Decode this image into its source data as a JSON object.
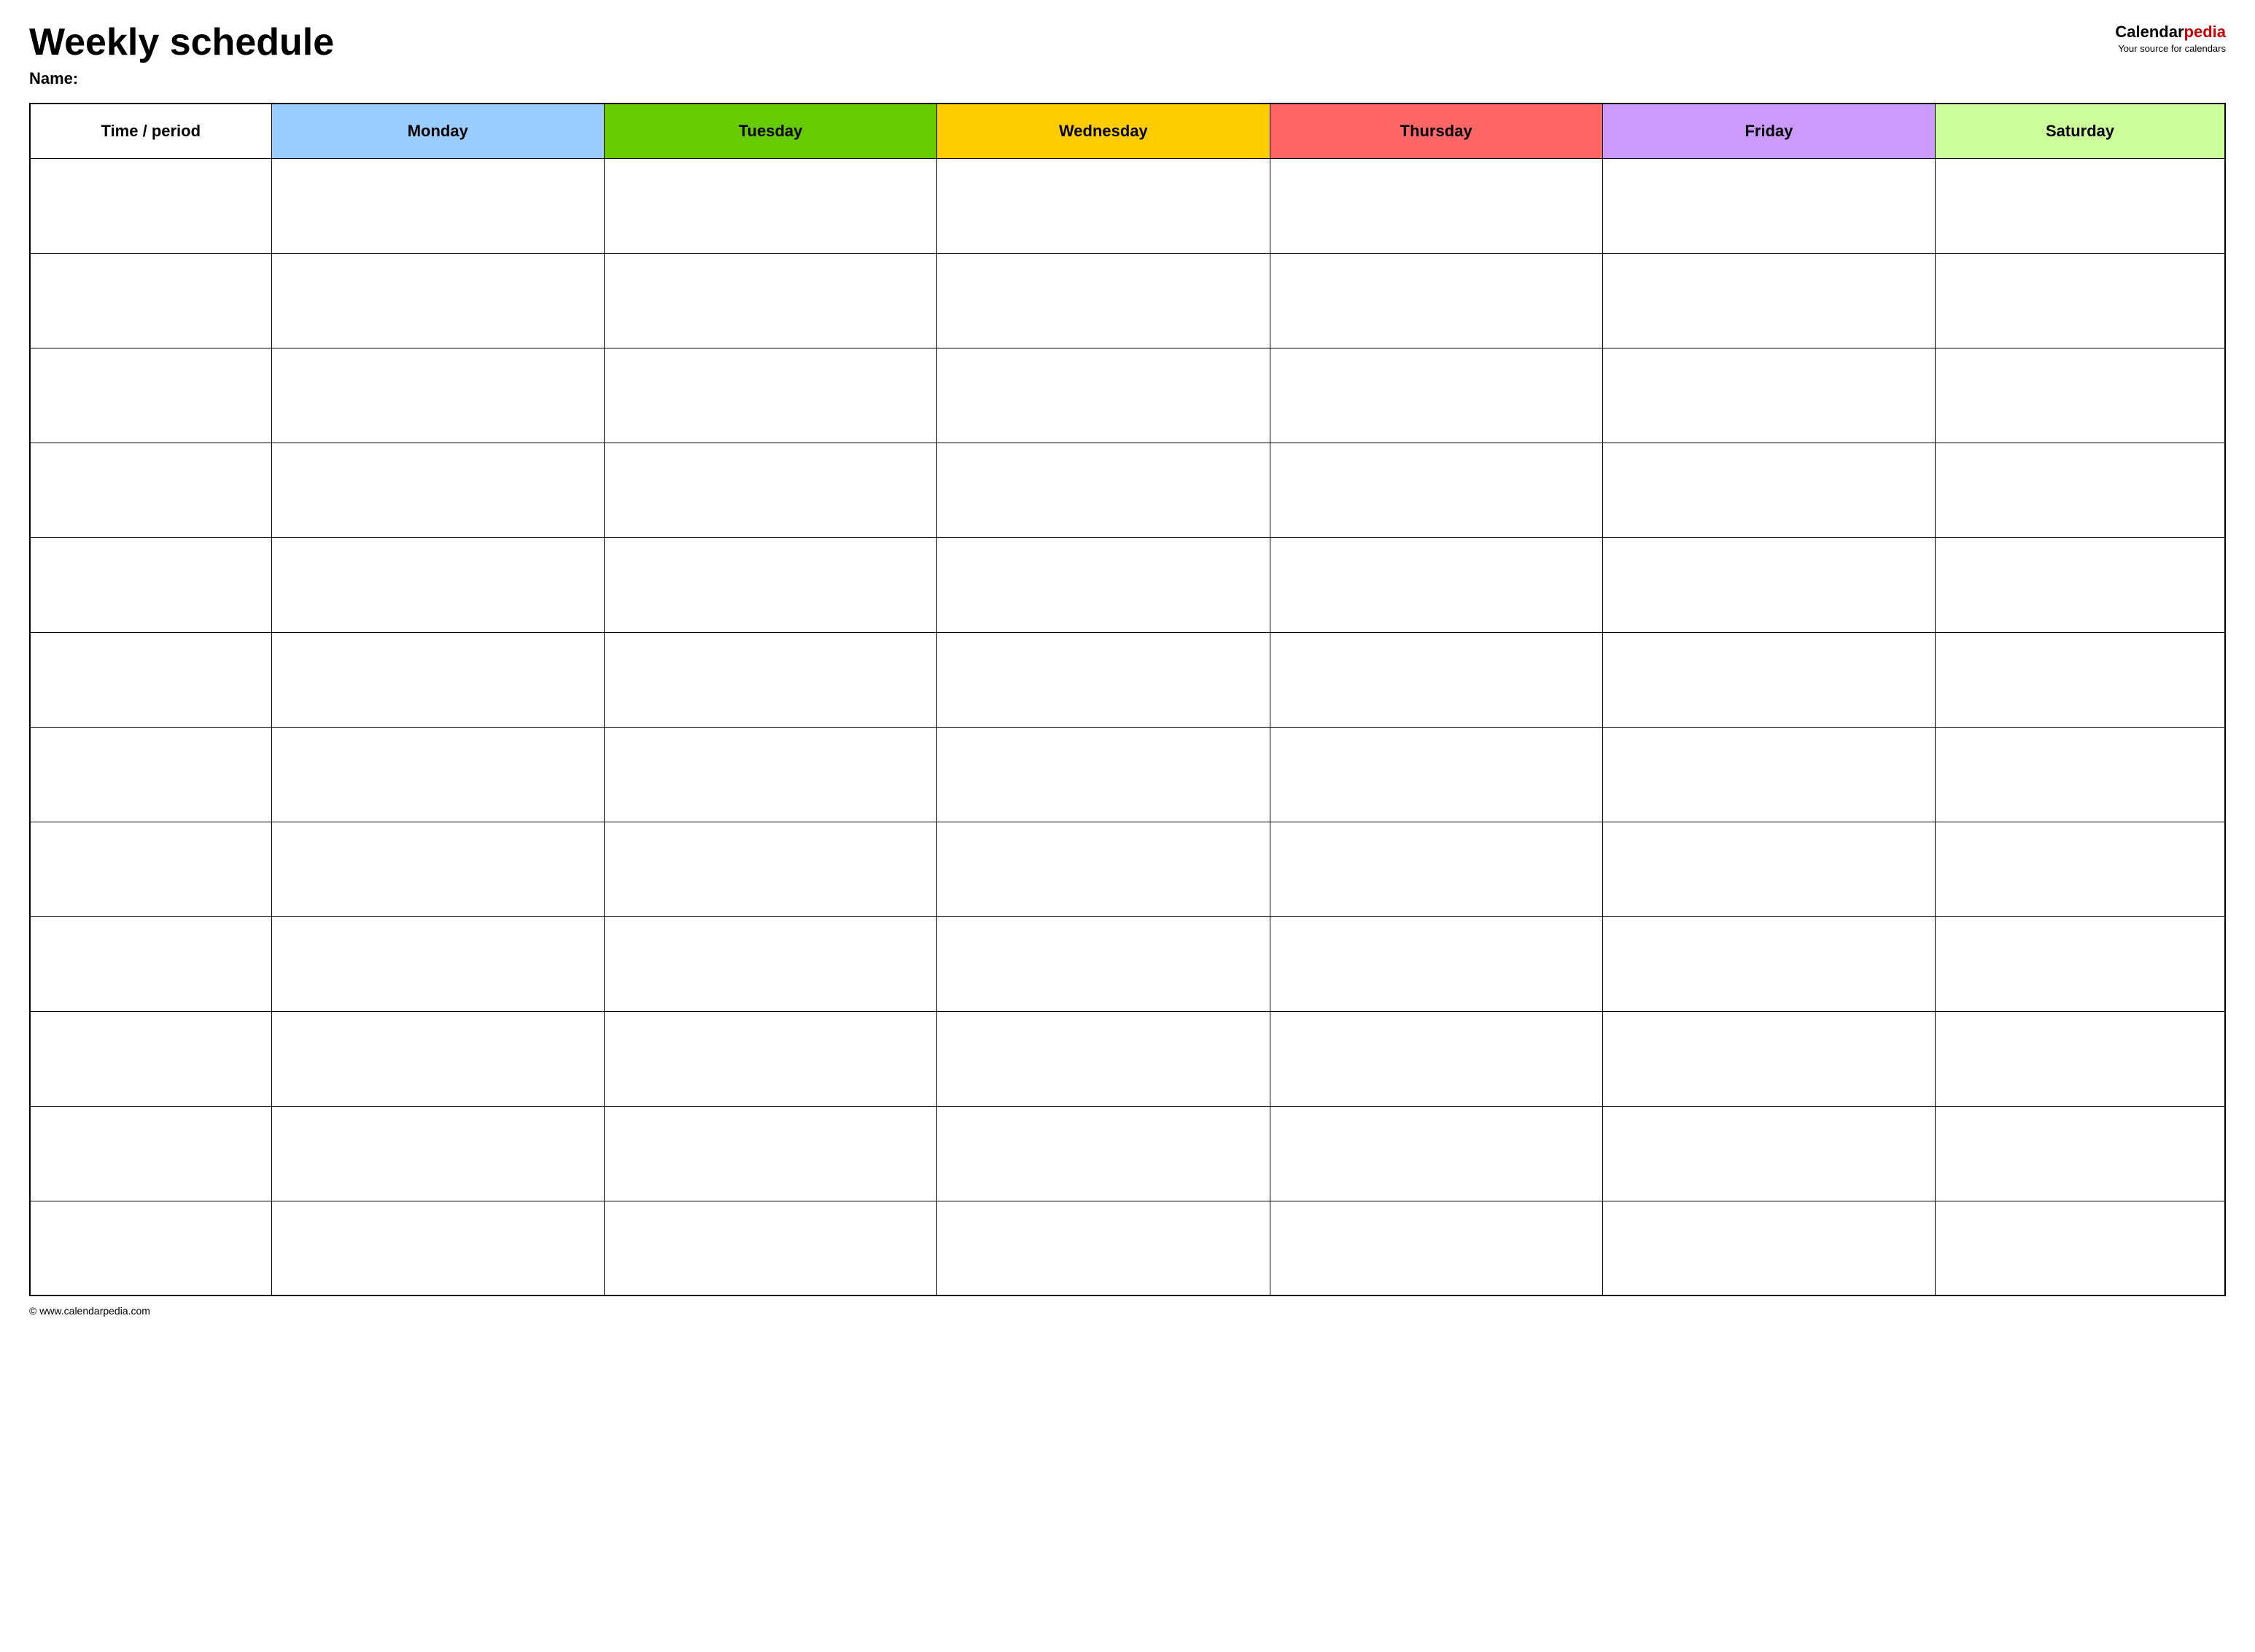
{
  "header": {
    "title": "Weekly schedule",
    "name_label": "Name:",
    "logo": {
      "calendar": "Calendar",
      "pedia": "pedia",
      "tagline": "Your source for calendars"
    }
  },
  "table": {
    "columns": [
      {
        "id": "time",
        "label": "Time / period",
        "class": "th-time"
      },
      {
        "id": "monday",
        "label": "Monday",
        "class": "th-monday"
      },
      {
        "id": "tuesday",
        "label": "Tuesday",
        "class": "th-tuesday"
      },
      {
        "id": "wednesday",
        "label": "Wednesday",
        "class": "th-wednesday"
      },
      {
        "id": "thursday",
        "label": "Thursday",
        "class": "th-thursday"
      },
      {
        "id": "friday",
        "label": "Friday",
        "class": "th-friday"
      },
      {
        "id": "saturday",
        "label": "Saturday",
        "class": "th-saturday"
      }
    ],
    "row_count": 12
  },
  "footer": {
    "url": "© www.calendarpedia.com"
  }
}
